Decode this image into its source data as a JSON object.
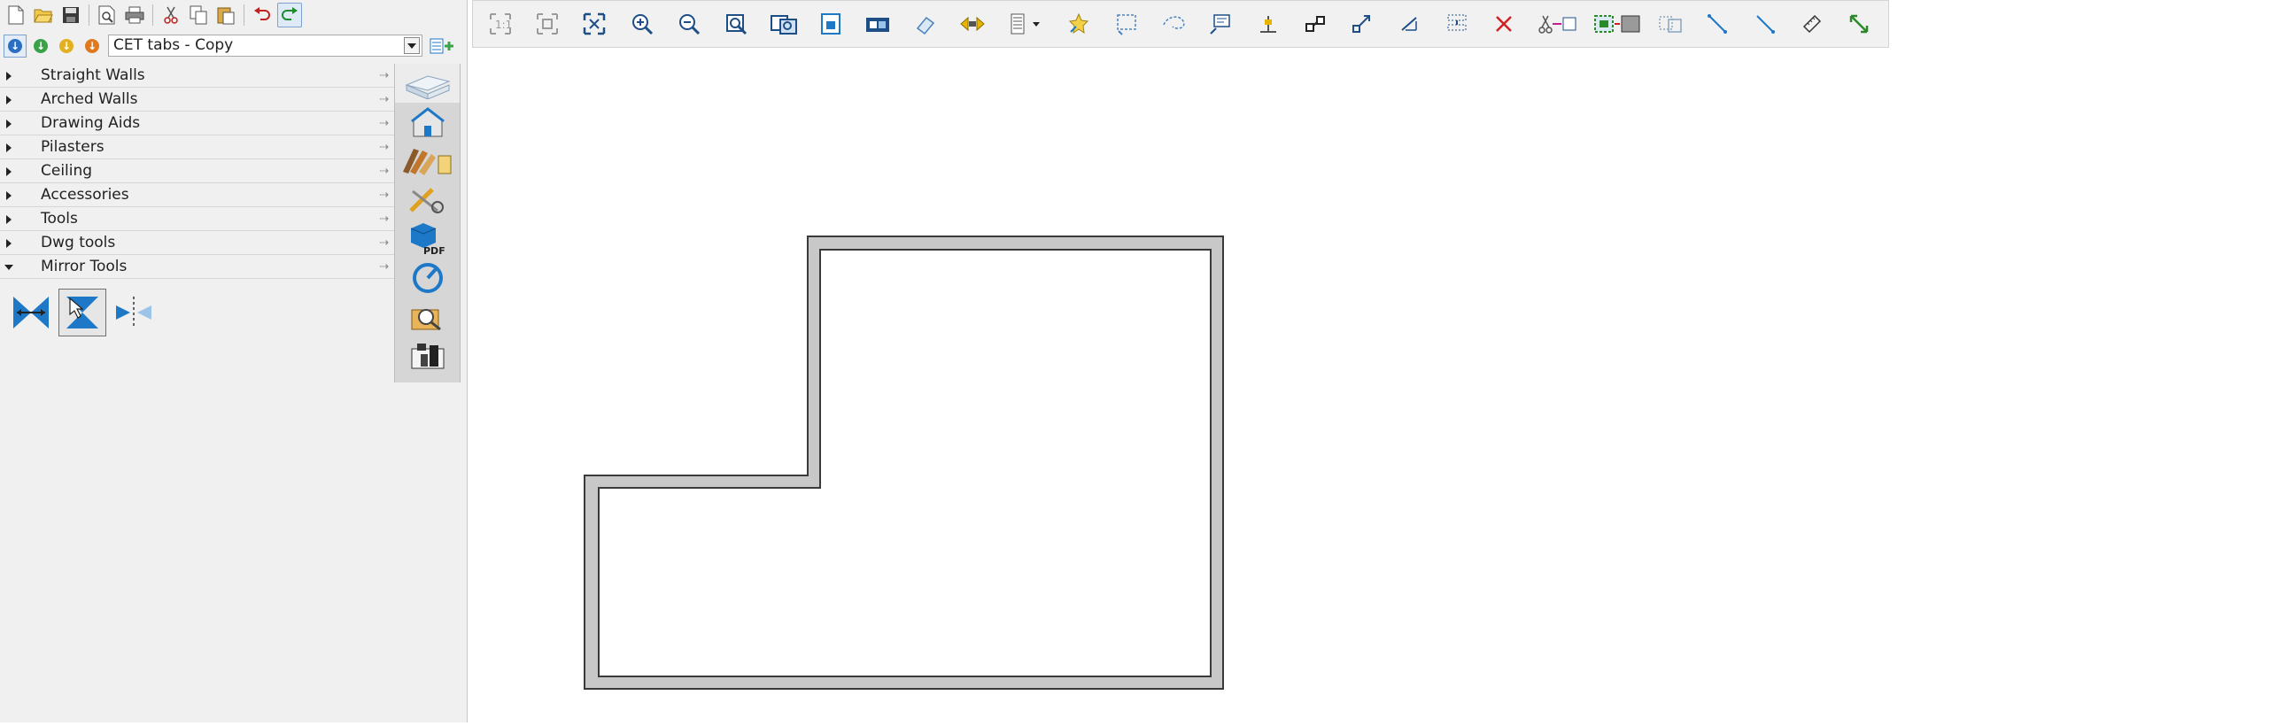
{
  "tab_selector": {
    "value": "CET tabs - Copy"
  },
  "categories": [
    {
      "label": "Straight Walls",
      "open": false
    },
    {
      "label": "Arched Walls",
      "open": false
    },
    {
      "label": "Drawing Aids",
      "open": false
    },
    {
      "label": "Pilasters",
      "open": false
    },
    {
      "label": "Ceiling",
      "open": false
    },
    {
      "label": "Accessories",
      "open": false
    },
    {
      "label": "Tools",
      "open": false
    },
    {
      "label": "Dwg tools",
      "open": false
    },
    {
      "label": "Mirror Tools",
      "open": true
    }
  ],
  "colors": {
    "accent_blue": "#1e78c8",
    "wall_fill": "#c8c8c8",
    "wall_stroke": "#3a3a3a",
    "delete_red": "#d22020",
    "toolbar_grey": "#9a9a9a",
    "highlight_yellow": "#e8b400"
  },
  "icons": {
    "quick_toolbar": [
      "new-file-icon",
      "open-folder-icon",
      "save-icon",
      "print-preview-icon",
      "print-icon",
      "cut-icon",
      "copy-icon",
      "paste-icon",
      "undo-icon",
      "redo-icon"
    ],
    "icon_strip": [
      "wall-block-icon",
      "house-icon",
      "materials-icon",
      "measure-tools-icon",
      "pdf-export-icon",
      "dial-gauge-icon",
      "zoom-catalog-icon",
      "render-camera-icon"
    ],
    "mirror_tools": [
      "mirror-horizontal-icon",
      "mirror-vertical-icon",
      "mirror-axis-icon"
    ],
    "main_toolbar": [
      "zoom-1-1-icon",
      "zoom-previous-icon",
      "zoom-extents-icon",
      "zoom-in-icon",
      "zoom-out-icon",
      "zoom-window-icon",
      "zoom-multi-icon",
      "zoom-page-icon",
      "view-3d-icon",
      "eraser-icon",
      "stretch-icon",
      "layers-icon",
      "highlight-icon",
      "select-rectangle-icon",
      "select-lasso-icon",
      "select-info-icon",
      "snap-icon",
      "connect-icon",
      "scale-icon",
      "align-icon",
      "distribute-icon",
      "delete-icon",
      "cut-paste-icon",
      "group-icon",
      "ungroup-icon",
      "line-icon",
      "dimension-line-icon",
      "measure-icon",
      "resize-icon"
    ]
  }
}
